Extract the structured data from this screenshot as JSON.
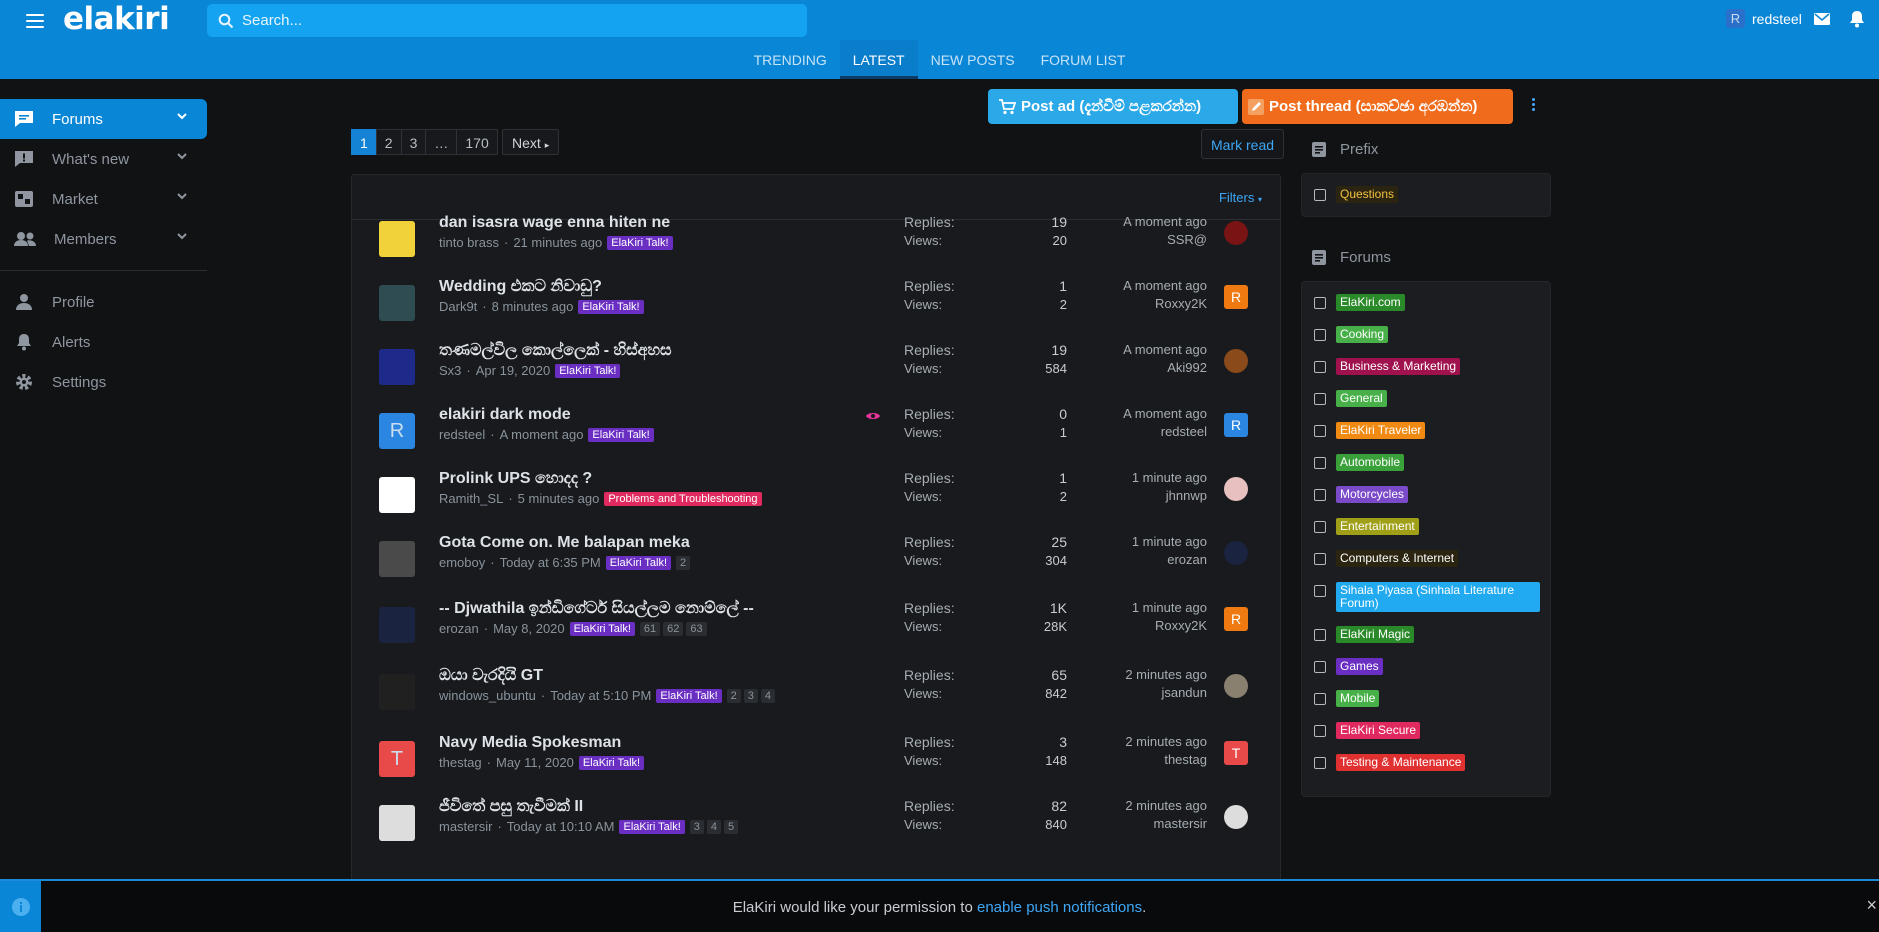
{
  "header": {
    "logo": "elakiri",
    "search_placeholder": "Search...",
    "username": "redsteel",
    "user_initial": "R"
  },
  "tabs": [
    {
      "label": "TRENDING"
    },
    {
      "label": "LATEST"
    },
    {
      "label": "NEW POSTS"
    },
    {
      "label": "FORUM LIST"
    }
  ],
  "sidebar": {
    "items": [
      {
        "label": "Forums"
      },
      {
        "label": "What's new"
      },
      {
        "label": "Market"
      },
      {
        "label": "Members"
      },
      {
        "label": "Profile"
      },
      {
        "label": "Alerts"
      },
      {
        "label": "Settings"
      }
    ]
  },
  "actions": {
    "post_ad": "Post ad (දැන්වීම් පළකරන්න)",
    "post_thread": "Post thread (සාකච්ඡා අරඹන්න)",
    "mark_read": "Mark read",
    "filters": "Filters"
  },
  "pager": {
    "pages": [
      "1",
      "2",
      "3",
      "…",
      "170"
    ],
    "next": "Next"
  },
  "labels": {
    "replies": "Replies:",
    "views": "Views:"
  },
  "threads": [
    {
      "title": "dan isasra wage enna hiten ne",
      "author": "tinto brass",
      "time": "21 minutes ago",
      "label": "ElaKiri Talk!",
      "label_color": "#6a2fc2",
      "pages": [],
      "replies": "19",
      "views": "20",
      "last_time": "A moment ago",
      "last_user": "SSR@",
      "last_av": "#7a1414",
      "last_init": "",
      "avatar": "#f2d23a"
    },
    {
      "title": "Wedding එකට නිවාඩු?",
      "author": "Dark9t",
      "time": "8 minutes ago",
      "label": "ElaKiri Talk!",
      "label_color": "#6a2fc2",
      "pages": [],
      "replies": "1",
      "views": "2",
      "last_time": "A moment ago",
      "last_user": "Roxxy2K",
      "last_av": "#f07a12",
      "last_init": "R",
      "avatar": "#2e4c52"
    },
    {
      "title": "තණමල්විල කොල්ලෙක් - හිස්අහස",
      "author": "Sx3",
      "time": "Apr 19, 2020",
      "label": "ElaKiri Talk!",
      "label_color": "#6a2fc2",
      "pages": [],
      "replies": "19",
      "views": "584",
      "last_time": "A moment ago",
      "last_user": "Aki992",
      "last_av": "#8a4a1a",
      "last_init": "",
      "avatar": "#1e2a8a"
    },
    {
      "title": "elakiri dark mode",
      "author": "redsteel",
      "time": "A moment ago",
      "label": "ElaKiri Talk!",
      "label_color": "#6a2fc2",
      "pages": [],
      "replies": "0",
      "views": "1",
      "last_time": "A moment ago",
      "last_user": "redsteel",
      "last_av": "#2a86e0",
      "last_init": "R",
      "avatar": "#2a86e0",
      "avatar_init": "R"
    },
    {
      "title": "Prolink UPS හොදද ?",
      "author": "Ramith_SL",
      "time": "5 minutes ago",
      "label": "Problems and Troubleshooting",
      "label_color": "#e0295e",
      "pages": [],
      "replies": "1",
      "views": "2",
      "last_time": "1 minute ago",
      "last_user": "jhnnwp",
      "last_av": "#e8c0c0",
      "last_init": "",
      "avatar": "#ffffff"
    },
    {
      "title": "Gota Come on. Me balapan meka",
      "author": "emoboy",
      "time": "Today at 6:35 PM",
      "label": "ElaKiri Talk!",
      "label_color": "#6a2fc2",
      "pages": [
        "2"
      ],
      "replies": "25",
      "views": "304",
      "last_time": "1 minute ago",
      "last_user": "erozan",
      "last_av": "#1a2440",
      "last_init": "",
      "avatar": "#4a4a4a"
    },
    {
      "title": "-- Djwathila ඉන්ඩිගේටර් සියල්ලම නොම්ලේ --",
      "author": "erozan",
      "time": "May 8, 2020",
      "label": "ElaKiri Talk!",
      "label_color": "#6a2fc2",
      "pages": [
        "61",
        "62",
        "63"
      ],
      "replies": "1K",
      "views": "28K",
      "last_time": "1 minute ago",
      "last_user": "Roxxy2K",
      "last_av": "#f07a12",
      "last_init": "R",
      "avatar": "#1a2440"
    },
    {
      "title": "ඔයා වැරදියි GT",
      "author": "windows_ubuntu",
      "time": "Today at 5:10 PM",
      "label": "ElaKiri Talk!",
      "label_color": "#6a2fc2",
      "pages": [
        "2",
        "3",
        "4"
      ],
      "replies": "65",
      "views": "842",
      "last_time": "2 minutes ago",
      "last_user": "jsandun",
      "last_av": "#8a8070",
      "last_init": "",
      "avatar": "#202020"
    },
    {
      "title": "Navy Media Spokesman",
      "author": "thestag",
      "time": "May 11, 2020",
      "label": "ElaKiri Talk!",
      "label_color": "#6a2fc2",
      "pages": [],
      "replies": "3",
      "views": "148",
      "last_time": "2 minutes ago",
      "last_user": "thestag",
      "last_av": "#e84a4a",
      "last_init": "T",
      "avatar": "#e84a4a",
      "avatar_init": "T"
    },
    {
      "title": "ජීවිතේ පසු තැවීමක් II",
      "author": "mastersir",
      "time": "Today at 10:10 AM",
      "label": "ElaKiri Talk!",
      "label_color": "#6a2fc2",
      "pages": [
        "3",
        "4",
        "5"
      ],
      "replies": "82",
      "views": "840",
      "last_time": "2 minutes ago",
      "last_user": "mastersir",
      "last_av": "#ddd",
      "last_init": "",
      "avatar": "#ddd"
    }
  ],
  "prefix": {
    "heading": "Prefix",
    "items": [
      {
        "label": "Questions",
        "color": "#2b2410",
        "text": "#f0c040"
      }
    ]
  },
  "forums": {
    "heading": "Forums",
    "items": [
      {
        "label": "ElaKiri.com",
        "color": "#2a8a2a"
      },
      {
        "label": "Cooking",
        "color": "#48b048"
      },
      {
        "label": "Business & Marketing",
        "color": "#a0124e"
      },
      {
        "label": "General",
        "color": "#48b048"
      },
      {
        "label": "ElaKiri Traveler",
        "color": "#f08a12"
      },
      {
        "label": "Automobile",
        "color": "#3aa03a"
      },
      {
        "label": "Motorcycles",
        "color": "#7a4ac8"
      },
      {
        "label": "Entertainment",
        "color": "#a0a018"
      },
      {
        "label": "Computers & Internet",
        "color": "#2a2410"
      },
      {
        "label": "Sihala Piyasa (Sinhala Literature Forum)",
        "color": "#22aaf0"
      },
      {
        "label": "ElaKiri Magic",
        "color": "#2a8a2a"
      },
      {
        "label": "Games",
        "color": "#6a2fc2"
      },
      {
        "label": "Mobile",
        "color": "#48b048"
      },
      {
        "label": "ElaKiri Secure",
        "color": "#e0295e"
      },
      {
        "label": "Testing & Maintenance",
        "color": "#e03030"
      }
    ]
  },
  "notice": {
    "text": "ElaKiri would like your permission to ",
    "link": "enable push notifications",
    "end": "."
  }
}
